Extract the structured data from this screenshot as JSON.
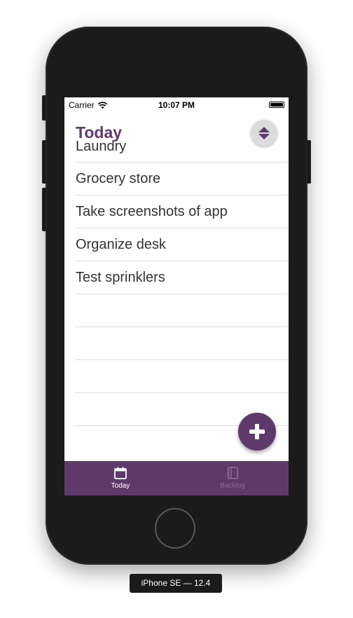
{
  "status_bar": {
    "carrier": "Carrier",
    "time": "10:07 PM"
  },
  "header": {
    "title": "Today"
  },
  "tasks": [
    "Laundry",
    "Grocery store",
    "Take screenshots of app",
    "Organize desk",
    "Test sprinklers",
    "",
    "",
    "",
    ""
  ],
  "tabs": [
    {
      "label": "Today",
      "icon": "calendar-icon"
    },
    {
      "label": "Backlog",
      "icon": "notebook-icon"
    }
  ],
  "simulator": {
    "device_label": "iPhone SE — 12.4"
  },
  "colors": {
    "accent": "#5e3a6b",
    "inactive_tab": "#8a6e93",
    "sort_button": "#dcdcdc"
  }
}
